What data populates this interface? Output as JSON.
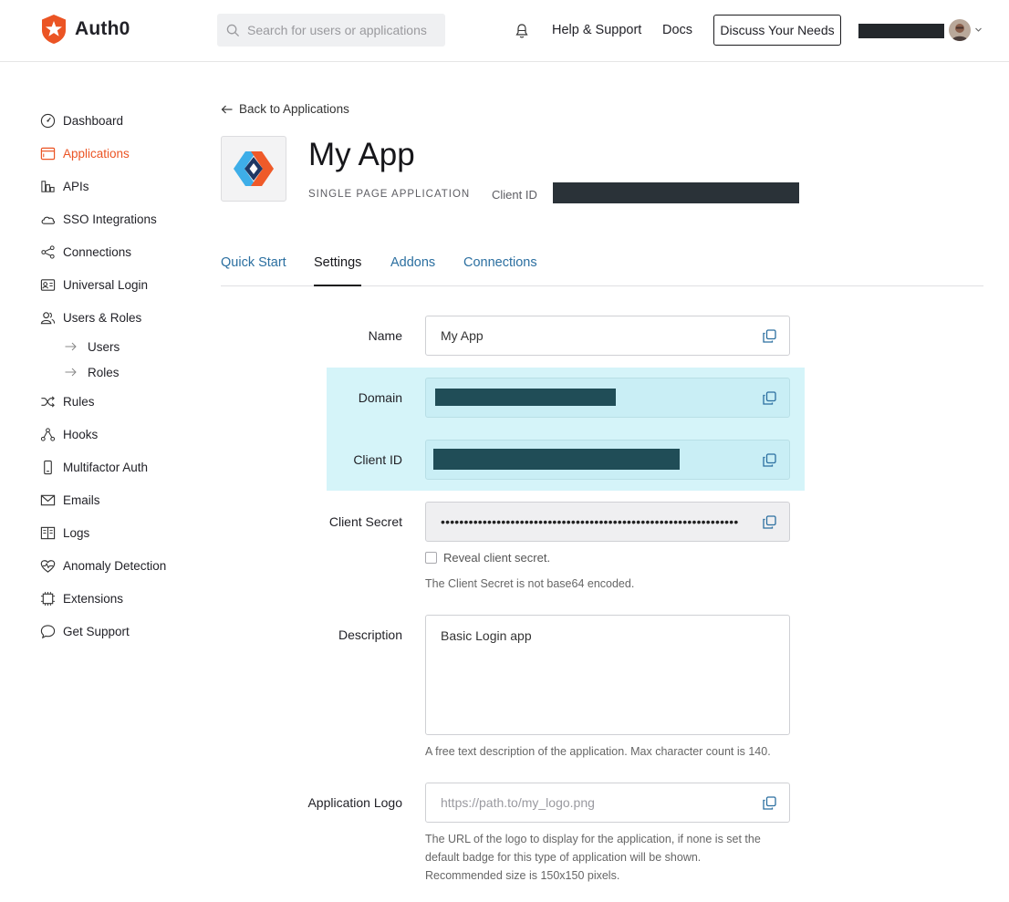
{
  "header": {
    "brand": "Auth0",
    "search_placeholder": "Search for users or applications",
    "help_label": "Help & Support",
    "docs_label": "Docs",
    "discuss_label": "Discuss Your Needs",
    "icons": [
      "auth0-logo",
      "search-icon",
      "bell-icon",
      "chevron-down-icon"
    ]
  },
  "sidebar": {
    "items": [
      {
        "label": "Dashboard",
        "icon": "gauge-icon",
        "active": false
      },
      {
        "label": "Applications",
        "icon": "browser-icon",
        "active": true
      },
      {
        "label": "APIs",
        "icon": "api-icon",
        "active": false
      },
      {
        "label": "SSO Integrations",
        "icon": "cloud-icon",
        "active": false
      },
      {
        "label": "Connections",
        "icon": "share-icon",
        "active": false
      },
      {
        "label": "Universal Login",
        "icon": "login-icon",
        "active": false
      },
      {
        "label": "Users & Roles",
        "icon": "users-icon",
        "active": false
      },
      {
        "label": "Rules",
        "icon": "shuffle-icon",
        "active": false
      },
      {
        "label": "Hooks",
        "icon": "hooks-icon",
        "active": false
      },
      {
        "label": "Multifactor Auth",
        "icon": "phone-icon",
        "active": false
      },
      {
        "label": "Emails",
        "icon": "mail-icon",
        "active": false
      },
      {
        "label": "Logs",
        "icon": "book-icon",
        "active": false
      },
      {
        "label": "Anomaly Detection",
        "icon": "heart-pulse-icon",
        "active": false
      },
      {
        "label": "Extensions",
        "icon": "chip-icon",
        "active": false
      },
      {
        "label": "Get Support",
        "icon": "chat-icon",
        "active": false
      }
    ],
    "subitems": [
      {
        "label": "Users"
      },
      {
        "label": "Roles"
      }
    ]
  },
  "main": {
    "back_label": "Back to Applications",
    "app_name": "My App",
    "app_type": "SINGLE PAGE APPLICATION",
    "client_id_label": "Client ID",
    "tabs": [
      {
        "label": "Quick Start",
        "active": false
      },
      {
        "label": "Settings",
        "active": true
      },
      {
        "label": "Addons",
        "active": false
      },
      {
        "label": "Connections",
        "active": false
      }
    ]
  },
  "form": {
    "name_label": "Name",
    "name_value": "My App",
    "domain_label": "Domain",
    "client_id_label": "Client ID",
    "secret_label": "Client Secret",
    "secret_value": "••••••••••••••••••••••••••••••••••••••••••••••••••••••••••••••••",
    "reveal_label": "Reveal client secret.",
    "secret_hint": "The Client Secret is not base64 encoded.",
    "description_label": "Description",
    "description_value": "Basic Login app",
    "description_hint": "A free text description of the application. Max character count is 140.",
    "logo_label": "Application Logo",
    "logo_placeholder": "https://path.to/my_logo.png",
    "logo_hint_1": "The URL of the logo to display for the application, if none is set the",
    "logo_hint_2": "default badge for this type of application will be shown.",
    "logo_hint_3": "Recommended size is 150x150 pixels."
  },
  "colors": {
    "accent": "#eb5424",
    "link": "#2b6fa0",
    "highlight": "#d5f4f9"
  }
}
